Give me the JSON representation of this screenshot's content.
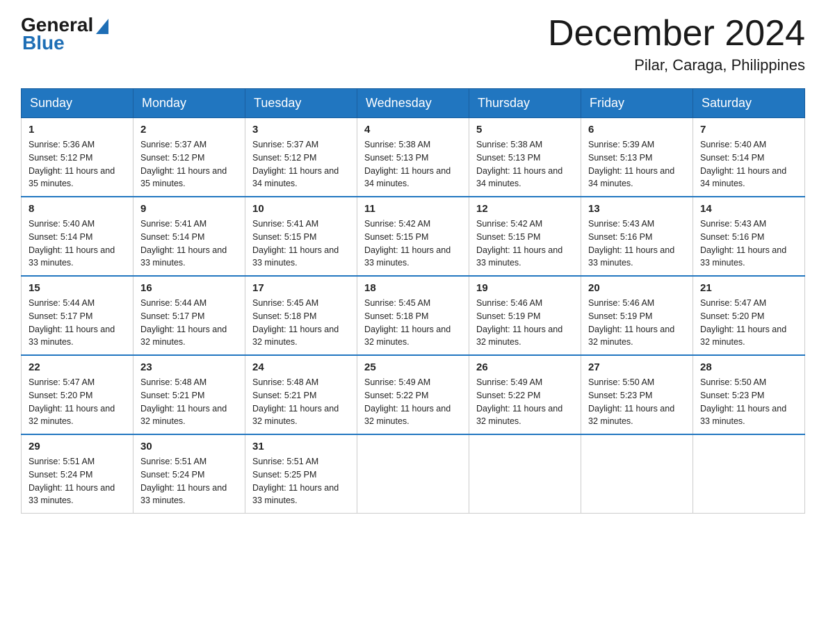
{
  "logo": {
    "general": "General",
    "blue": "Blue"
  },
  "header": {
    "month_year": "December 2024",
    "location": "Pilar, Caraga, Philippines"
  },
  "weekdays": [
    "Sunday",
    "Monday",
    "Tuesday",
    "Wednesday",
    "Thursday",
    "Friday",
    "Saturday"
  ],
  "weeks": [
    [
      {
        "day": "1",
        "sunrise": "5:36 AM",
        "sunset": "5:12 PM",
        "daylight": "11 hours and 35 minutes."
      },
      {
        "day": "2",
        "sunrise": "5:37 AM",
        "sunset": "5:12 PM",
        "daylight": "11 hours and 35 minutes."
      },
      {
        "day": "3",
        "sunrise": "5:37 AM",
        "sunset": "5:12 PM",
        "daylight": "11 hours and 34 minutes."
      },
      {
        "day": "4",
        "sunrise": "5:38 AM",
        "sunset": "5:13 PM",
        "daylight": "11 hours and 34 minutes."
      },
      {
        "day": "5",
        "sunrise": "5:38 AM",
        "sunset": "5:13 PM",
        "daylight": "11 hours and 34 minutes."
      },
      {
        "day": "6",
        "sunrise": "5:39 AM",
        "sunset": "5:13 PM",
        "daylight": "11 hours and 34 minutes."
      },
      {
        "day": "7",
        "sunrise": "5:40 AM",
        "sunset": "5:14 PM",
        "daylight": "11 hours and 34 minutes."
      }
    ],
    [
      {
        "day": "8",
        "sunrise": "5:40 AM",
        "sunset": "5:14 PM",
        "daylight": "11 hours and 33 minutes."
      },
      {
        "day": "9",
        "sunrise": "5:41 AM",
        "sunset": "5:14 PM",
        "daylight": "11 hours and 33 minutes."
      },
      {
        "day": "10",
        "sunrise": "5:41 AM",
        "sunset": "5:15 PM",
        "daylight": "11 hours and 33 minutes."
      },
      {
        "day": "11",
        "sunrise": "5:42 AM",
        "sunset": "5:15 PM",
        "daylight": "11 hours and 33 minutes."
      },
      {
        "day": "12",
        "sunrise": "5:42 AM",
        "sunset": "5:15 PM",
        "daylight": "11 hours and 33 minutes."
      },
      {
        "day": "13",
        "sunrise": "5:43 AM",
        "sunset": "5:16 PM",
        "daylight": "11 hours and 33 minutes."
      },
      {
        "day": "14",
        "sunrise": "5:43 AM",
        "sunset": "5:16 PM",
        "daylight": "11 hours and 33 minutes."
      }
    ],
    [
      {
        "day": "15",
        "sunrise": "5:44 AM",
        "sunset": "5:17 PM",
        "daylight": "11 hours and 33 minutes."
      },
      {
        "day": "16",
        "sunrise": "5:44 AM",
        "sunset": "5:17 PM",
        "daylight": "11 hours and 32 minutes."
      },
      {
        "day": "17",
        "sunrise": "5:45 AM",
        "sunset": "5:18 PM",
        "daylight": "11 hours and 32 minutes."
      },
      {
        "day": "18",
        "sunrise": "5:45 AM",
        "sunset": "5:18 PM",
        "daylight": "11 hours and 32 minutes."
      },
      {
        "day": "19",
        "sunrise": "5:46 AM",
        "sunset": "5:19 PM",
        "daylight": "11 hours and 32 minutes."
      },
      {
        "day": "20",
        "sunrise": "5:46 AM",
        "sunset": "5:19 PM",
        "daylight": "11 hours and 32 minutes."
      },
      {
        "day": "21",
        "sunrise": "5:47 AM",
        "sunset": "5:20 PM",
        "daylight": "11 hours and 32 minutes."
      }
    ],
    [
      {
        "day": "22",
        "sunrise": "5:47 AM",
        "sunset": "5:20 PM",
        "daylight": "11 hours and 32 minutes."
      },
      {
        "day": "23",
        "sunrise": "5:48 AM",
        "sunset": "5:21 PM",
        "daylight": "11 hours and 32 minutes."
      },
      {
        "day": "24",
        "sunrise": "5:48 AM",
        "sunset": "5:21 PM",
        "daylight": "11 hours and 32 minutes."
      },
      {
        "day": "25",
        "sunrise": "5:49 AM",
        "sunset": "5:22 PM",
        "daylight": "11 hours and 32 minutes."
      },
      {
        "day": "26",
        "sunrise": "5:49 AM",
        "sunset": "5:22 PM",
        "daylight": "11 hours and 32 minutes."
      },
      {
        "day": "27",
        "sunrise": "5:50 AM",
        "sunset": "5:23 PM",
        "daylight": "11 hours and 32 minutes."
      },
      {
        "day": "28",
        "sunrise": "5:50 AM",
        "sunset": "5:23 PM",
        "daylight": "11 hours and 33 minutes."
      }
    ],
    [
      {
        "day": "29",
        "sunrise": "5:51 AM",
        "sunset": "5:24 PM",
        "daylight": "11 hours and 33 minutes."
      },
      {
        "day": "30",
        "sunrise": "5:51 AM",
        "sunset": "5:24 PM",
        "daylight": "11 hours and 33 minutes."
      },
      {
        "day": "31",
        "sunrise": "5:51 AM",
        "sunset": "5:25 PM",
        "daylight": "11 hours and 33 minutes."
      },
      null,
      null,
      null,
      null
    ]
  ],
  "labels": {
    "sunrise_prefix": "Sunrise: ",
    "sunset_prefix": "Sunset: ",
    "daylight_prefix": "Daylight: "
  }
}
